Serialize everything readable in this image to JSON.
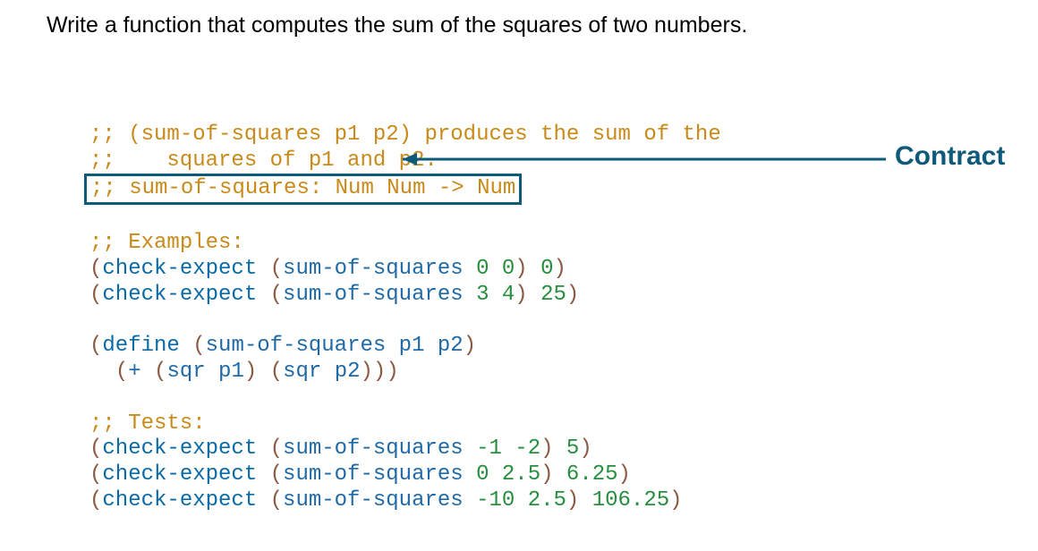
{
  "prompt": "Write a function that computes the sum of the squares of two numbers.",
  "annotation": {
    "label": "Contract"
  },
  "code": {
    "purpose_line1_prefix": ";; ",
    "purpose_line1_text": "(sum-of-squares p1 p2) produces the sum of the",
    "purpose_line2_prefix": ";;    ",
    "purpose_line2_text": "squares of p1 and p2.",
    "contract_prefix": ";; ",
    "contract_text": "sum-of-squares: Num Num -> Num",
    "examples_header": ";; Examples:",
    "ex1": {
      "lp": "(",
      "fn": "check-expect",
      "sp": " ",
      "lp2": "(",
      "call": "sum-of-squares",
      "args": " 0 0",
      "rp2": ")",
      "res": " 0",
      "rp": ")"
    },
    "ex2": {
      "lp": "(",
      "fn": "check-expect",
      "sp": " ",
      "lp2": "(",
      "call": "sum-of-squares",
      "args": " 3 4",
      "rp2": ")",
      "res": " 25",
      "rp": ")"
    },
    "def": {
      "line1_lp": "(",
      "line1_kw": "define",
      "line1_sp": " ",
      "line1_lp2": "(",
      "line1_sig": "sum-of-squares p1 p2",
      "line1_rp2": ")",
      "line2_indent": "  ",
      "line2_lp": "(",
      "line2_op": "+",
      "line2_sp": " ",
      "line2_lp2": "(",
      "line2_c1": "sqr p1",
      "line2_rp2": ")",
      "line2_sp2": " ",
      "line2_lp3": "(",
      "line2_c2": "sqr p2",
      "line2_rp3": ")",
      "line2_rp4": ")",
      "line2_rp5": ")"
    },
    "tests_header": ";; Tests:",
    "t1": {
      "lp": "(",
      "fn": "check-expect",
      "sp": " ",
      "lp2": "(",
      "call": "sum-of-squares",
      "args": " -1 -2",
      "rp2": ")",
      "res": " 5",
      "rp": ")"
    },
    "t2": {
      "lp": "(",
      "fn": "check-expect",
      "sp": " ",
      "lp2": "(",
      "call": "sum-of-squares",
      "args": " 0 2.5",
      "rp2": ")",
      "res": " 6.25",
      "rp": ")"
    },
    "t3": {
      "lp": "(",
      "fn": "check-expect",
      "sp": " ",
      "lp2": "(",
      "call": "sum-of-squares",
      "args": " -10 2.5",
      "rp2": ")",
      "res": " 106.25",
      "rp": ")"
    }
  }
}
